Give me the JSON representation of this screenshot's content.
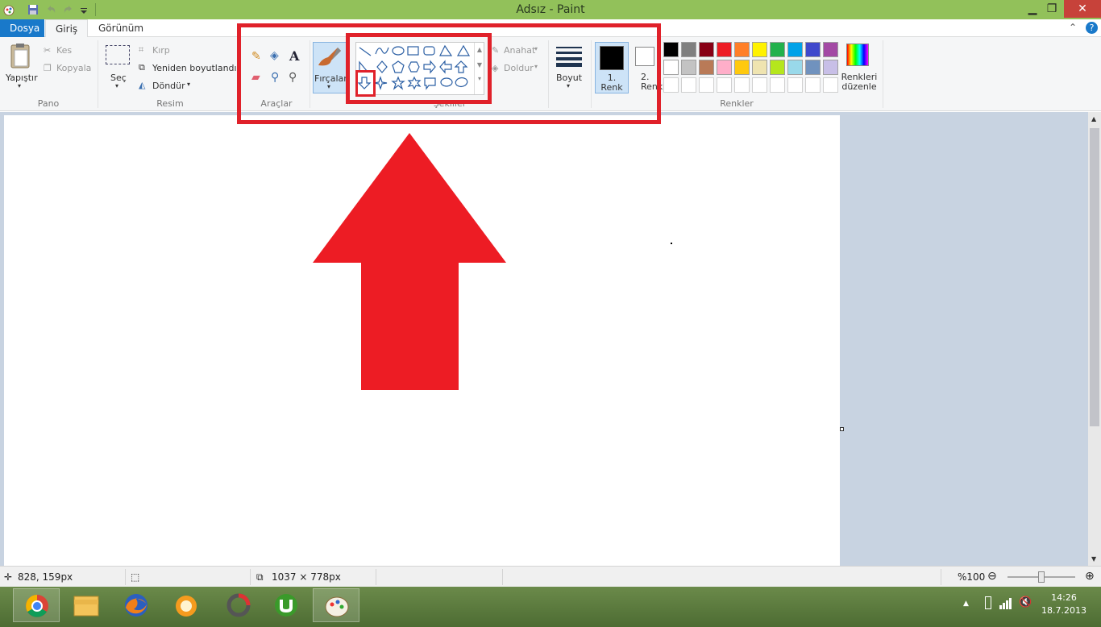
{
  "window": {
    "title": "Adsız - Paint"
  },
  "tabs": {
    "file": "Dosya",
    "home": "Giriş",
    "view": "Görünüm"
  },
  "ribbon": {
    "clipboard": {
      "paste": "Yapıştır",
      "cut": "Kes",
      "copy": "Kopyala",
      "label": "Pano"
    },
    "image": {
      "select": "Seç",
      "crop": "Kırp",
      "resize": "Yeniden boyutlandır",
      "rotate": "Döndür",
      "label": "Resim"
    },
    "tools": {
      "label": "Araçlar"
    },
    "brushes": {
      "label": "Fırçalar"
    },
    "shapes": {
      "outline": "Anahat",
      "fill": "Doldur",
      "label": "Şekiller"
    },
    "size": {
      "label": "Boyut"
    },
    "colors": {
      "color1": "1. Renk",
      "color1_a": "1.",
      "color1_b": "Renk",
      "color2_a": "2.",
      "color2_b": "Renk",
      "edit_a": "Renkleri",
      "edit_b": "düzenle",
      "label": "Renkler"
    }
  },
  "palette": {
    "row1": [
      "#000000",
      "#7f7f7f",
      "#880015",
      "#ed1c24",
      "#ff7f27",
      "#fff200",
      "#22b14c",
      "#00a2e8",
      "#3f48cc",
      "#a349a4"
    ],
    "row2": [
      "#ffffff",
      "#c3c3c3",
      "#b97a57",
      "#ffaec9",
      "#ffc90e",
      "#efe4b0",
      "#b5e61d",
      "#99d9ea",
      "#7092be",
      "#c8bfe7"
    ],
    "row3": [
      "#ffffff",
      "#ffffff",
      "#ffffff",
      "#ffffff",
      "#ffffff",
      "#ffffff",
      "#ffffff",
      "#ffffff",
      "#ffffff",
      "#ffffff"
    ]
  },
  "status": {
    "cursor_pos": "828, 159px",
    "canvas_size": "1037 × 778px",
    "zoom": "%100"
  },
  "taskbar": {
    "time": "14:26",
    "date": "18.7.2013"
  },
  "colors": {
    "highlight": "#e0212a",
    "titlebar": "#92c15a",
    "file_tab": "#1979ca",
    "arrow": "#ed1c24"
  }
}
